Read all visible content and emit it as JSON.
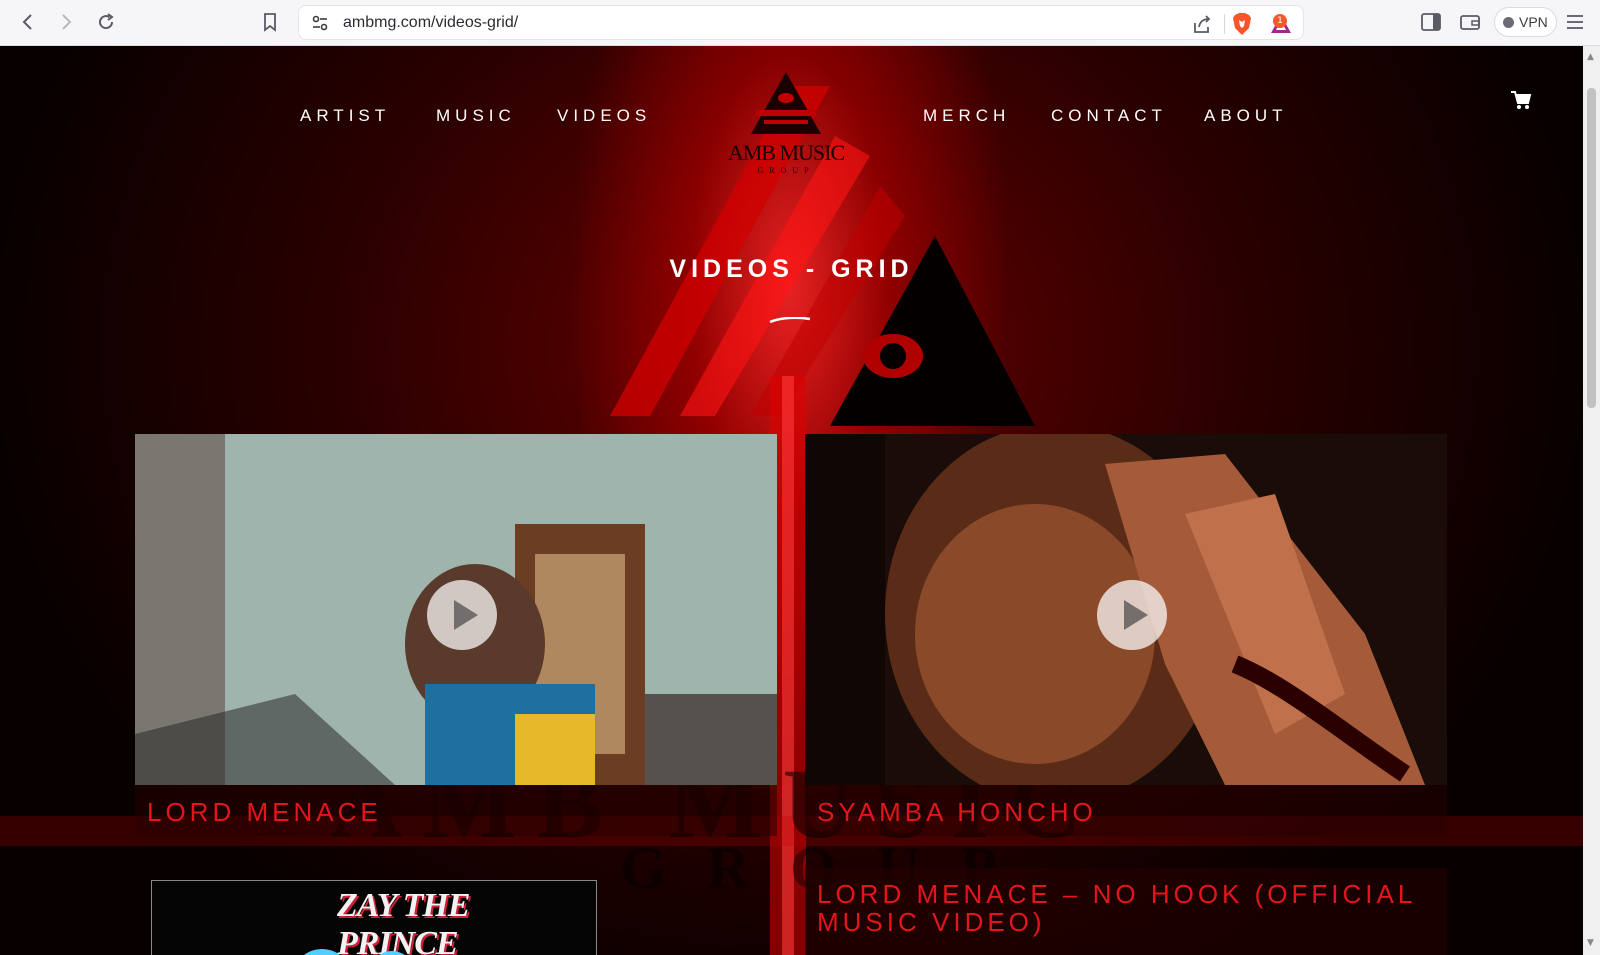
{
  "browser": {
    "url": "ambmg.com/videos-grid/",
    "vpn_label": "VPN",
    "rewards_badge": "1"
  },
  "site": {
    "logo_text": "AMB MUSIC",
    "logo_sub": "GROUP",
    "nav_left": [
      "ARTIST",
      "MUSIC",
      "VIDEOS"
    ],
    "nav_right": [
      "MERCH",
      "CONTACT",
      "ABOUT"
    ]
  },
  "page": {
    "title": "VIDEOS - GRID"
  },
  "videos": [
    {
      "caption": "LORD MENACE"
    },
    {
      "caption": "SYAMBA HONCHO"
    },
    {
      "caption": "ZAY THE PRINCE"
    },
    {
      "caption": "LORD MENACE – NO HOOK (OFFICIAL MUSIC VIDEO)"
    }
  ],
  "colors": {
    "accent": "#e2161a",
    "background": "#000000",
    "glow": "#ff2020"
  }
}
